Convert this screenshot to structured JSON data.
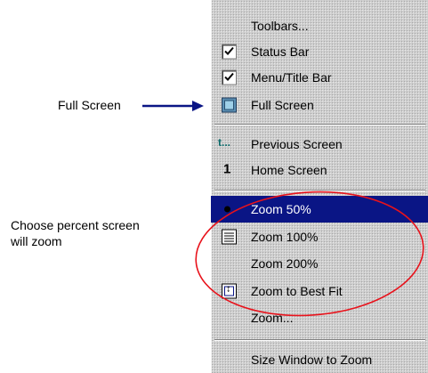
{
  "menu": {
    "toolbars": "Toolbars...",
    "status_bar": "Status Bar",
    "menu_title_bar": "Menu/Title Bar",
    "full_screen": "Full Screen",
    "previous_screen": "Previous Screen",
    "previous_icon": "t...",
    "home_screen": "Home Screen",
    "home_icon": "1",
    "zoom_50": "Zoom 50%",
    "zoom_100": "Zoom 100%",
    "zoom_200": "Zoom 200%",
    "zoom_best_fit": "Zoom to Best Fit",
    "zoom": "Zoom...",
    "size_window": "Size Window to Zoom",
    "status_bar_checked": true,
    "menu_title_bar_checked": true,
    "selected_item": "Zoom 50%",
    "selection_color": "#0a1585"
  },
  "annotations": {
    "full_screen_label": "Full Screen",
    "zoom_line1": "Choose percent screen",
    "zoom_line2": "will zoom",
    "arrow_color": "#0a1585",
    "ellipse_color": "#e8121b"
  },
  "icons": {
    "check": "checkmark-icon",
    "full_screen": "full-screen-icon",
    "previous": "previous-screen-icon",
    "home": "home-screen-icon",
    "bullet": "radio-bullet-icon",
    "zoom_100": "list-icon",
    "best_fit": "fit-icon"
  }
}
